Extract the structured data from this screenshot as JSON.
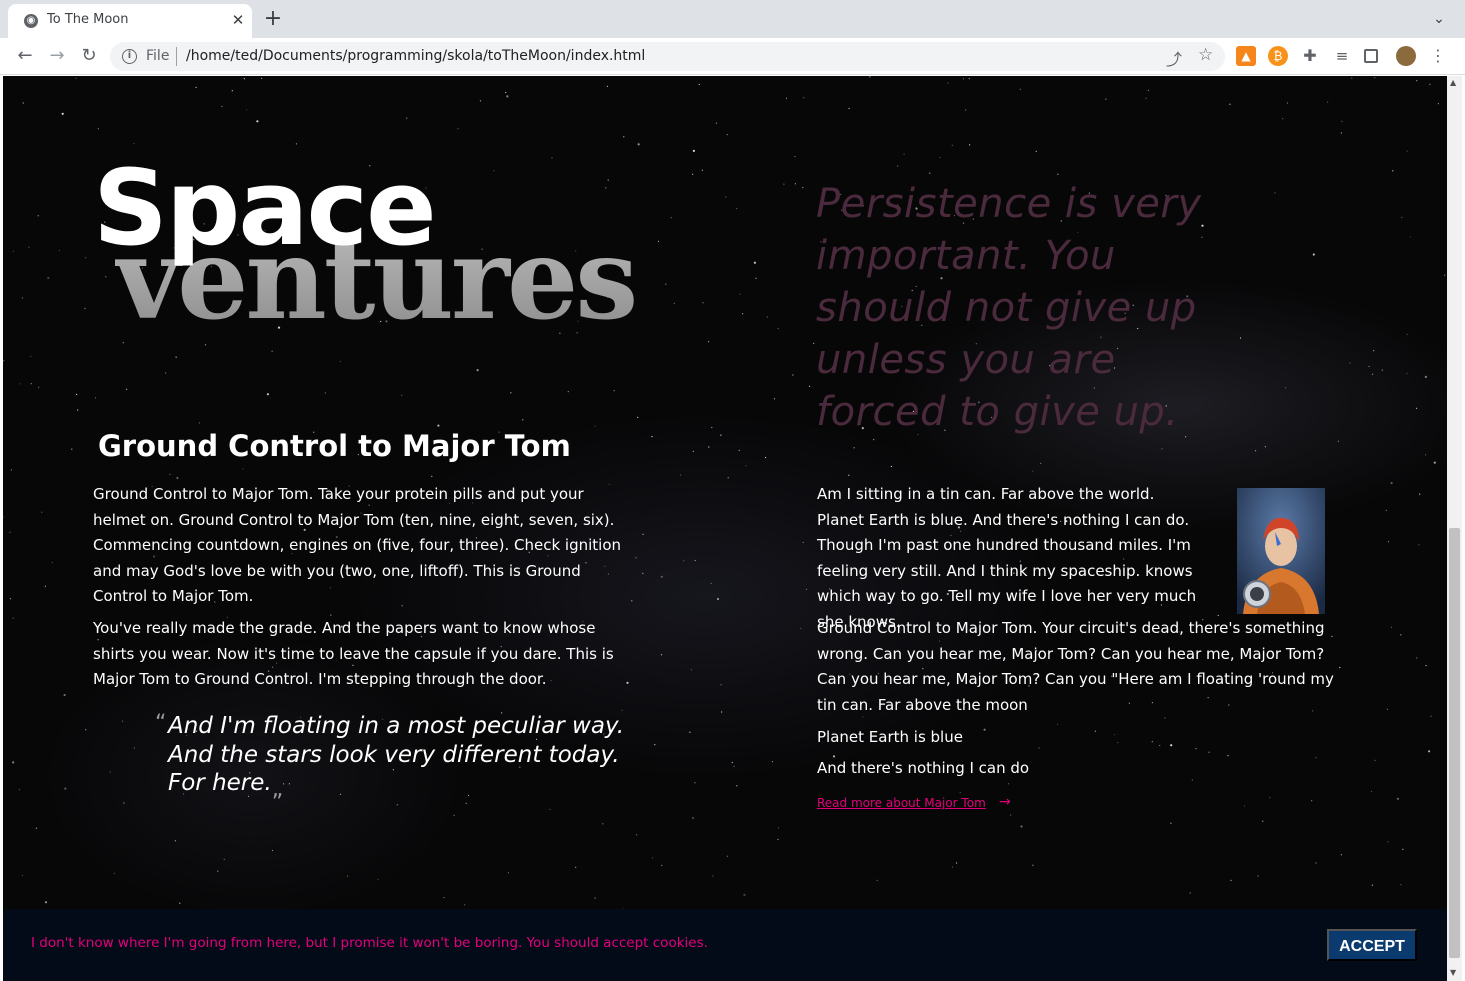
{
  "browser": {
    "tab_title": "To The Moon",
    "omnibox_scheme": "File",
    "url": "/home/ted/Documents/programming/skola/toTheMoon/index.html",
    "icons": {
      "favicon": "globe-icon",
      "close": "close-icon",
      "new_tab": "plus-icon",
      "tab_list": "chevron-down-icon",
      "back": "arrow-left-icon",
      "forward": "arrow-right-icon",
      "reload": "reload-icon",
      "info": "info-icon",
      "share": "share-icon",
      "bookmark": "star-icon",
      "extensions": [
        "metamask-icon",
        "bitcoin-icon",
        "puzzle-icon",
        "media-list-icon",
        "side-panel-icon",
        "profile-avatar",
        "kebab-menu-icon"
      ]
    }
  },
  "hero": {
    "title_top": "Space",
    "title_bottom": "ventures"
  },
  "right_quote": "Persistence is very important. You should not give up unless you are forced to give up.",
  "left_section": {
    "heading": "Ground Control to Major Tom",
    "paragraph_1": "Ground Control to Major Tom. Take your protein pills and put your helmet on. Ground Control to Major Tom (ten, nine, eight, seven, six). Commencing countdown, engines on (five, four, three). Check ignition and may God's love be with you (two, one, liftoff). This is Ground Control to Major Tom.",
    "paragraph_2": "You've really made the grade. And the papers want to know whose shirts you wear. Now it's time to leave the capsule if you dare. This is Major Tom to Ground Control. I'm stepping through the door.",
    "blockquote": {
      "open_mark": "“",
      "line_1": "And I'm floating in a most peculiar way.",
      "line_2": "And the stars look very different today.",
      "line_3": "For here.",
      "close_mark": "„"
    }
  },
  "right_section": {
    "paragraph_1": "Am I sitting in a tin can. Far above the world. Planet Earth is blue. And there's nothing I can do. Though I'm past one hundred thousand miles. I'm feeling very still. And I think my spaceship. knows which way to go. Tell my wife I love her very much she knows.",
    "paragraph_2": "Ground Control to Major Tom. Your circuit's dead, there's something wrong. Can you hear me, Major Tom? Can you hear me, Major Tom? Can you hear me, Major Tom? Can you \"Here am I floating 'round my tin can. Far above the moon",
    "line_3": "Planet Earth is blue",
    "line_4": "And there's nothing I can do",
    "image": "astronaut-portrait",
    "read_more_label": "Read more about Major Tom",
    "read_more_arrow": "→"
  },
  "cookie_bar": {
    "text": "I don't know where I'm going from here, but I promise it won't be boring. You should accept cookies.",
    "accept_label": "ACCEPT"
  },
  "colors": {
    "accent_pink": "#e4007c",
    "quote_color": "#4a2a3c",
    "cookie_bg": "#030b18",
    "accept_bg": "#0b3a6e",
    "page_bg": "#070708"
  }
}
